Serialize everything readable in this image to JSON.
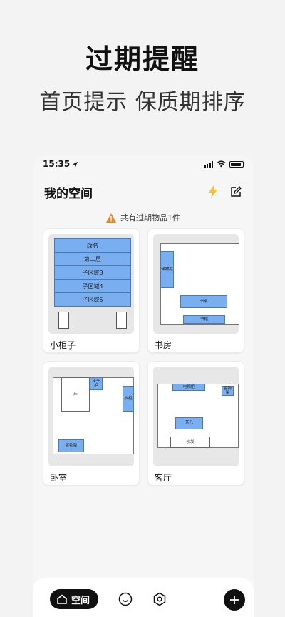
{
  "headline": "过期提醒",
  "subline": "首页提示 保质期排序",
  "status": {
    "time": "15:35"
  },
  "app": {
    "title": "我的空间",
    "notice": "共有过期物品1件"
  },
  "spaces": [
    {
      "name": "小柜子",
      "rows": [
        "改名",
        "第二层",
        "子区域3",
        "子区域4",
        "子区域5"
      ]
    },
    {
      "name": "书房",
      "items": [
        "储物柜",
        "书桌",
        "书柜"
      ]
    },
    {
      "name": "卧室",
      "items": [
        "床",
        "床头柜",
        "衣柜",
        "置物架"
      ]
    },
    {
      "name": "客厅",
      "items": [
        "电视柜",
        "置物架",
        "茶几",
        "沙发"
      ]
    }
  ],
  "tabbar": {
    "active_label": "空间"
  },
  "colors": {
    "furniture": "#79aff0",
    "accent_lightning": "#f2c230",
    "warning": "#e0892a"
  }
}
